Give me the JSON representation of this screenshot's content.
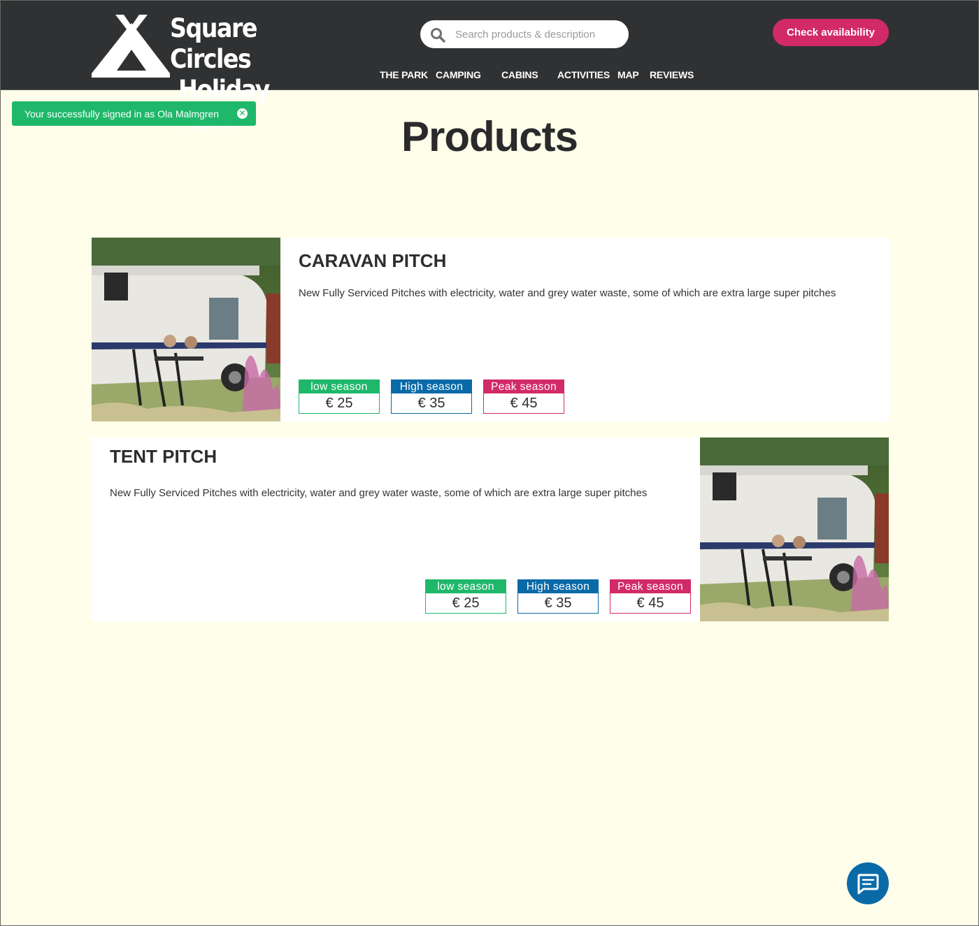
{
  "brand": {
    "line1": "Square Circles",
    "line2": "Holiday Park",
    "logo_icon": "tent-icon"
  },
  "search": {
    "placeholder": "Search products & description",
    "icon": "search-icon"
  },
  "cta": {
    "label": "Check availability"
  },
  "nav": {
    "items": [
      {
        "label": "THE PARK"
      },
      {
        "label": "CAMPING"
      },
      {
        "label": "CABINS"
      },
      {
        "label": "ACTIVITIES"
      },
      {
        "label": "MAP"
      },
      {
        "label": "REVIEWS"
      }
    ]
  },
  "toast": {
    "message": "Your successfully signed in as Ola Malmgren",
    "close_icon": "close-icon"
  },
  "page": {
    "title": "Products"
  },
  "products": [
    {
      "title": "CARAVAN PITCH",
      "description": "New Fully Serviced Pitches with electricity, water and grey water waste, some of which are extra large super pitches",
      "prices": [
        {
          "season": "low season",
          "price": "€ 25",
          "color": "#1fb86a"
        },
        {
          "season": "High season",
          "price": "€ 35",
          "color": "#0a6aa8"
        },
        {
          "season": "Peak season",
          "price": "€ 45",
          "color": "#d22a68"
        }
      ]
    },
    {
      "title": "TENT PITCH",
      "description": "New Fully Serviced Pitches with electricity, water and grey water waste, some of which are extra large super pitches",
      "prices": [
        {
          "season": "low season",
          "price": "€ 25",
          "color": "#1fb86a"
        },
        {
          "season": "High season",
          "price": "€ 35",
          "color": "#0a6aa8"
        },
        {
          "season": "Peak season",
          "price": "€ 45",
          "color": "#d22a68"
        }
      ]
    }
  ],
  "chat": {
    "icon": "chat-icon"
  },
  "colors": {
    "header_bg": "#303133",
    "page_bg": "#fffeea",
    "accent_pink": "#d22a68",
    "accent_green": "#1fb86a",
    "accent_blue": "#0a6aa8"
  }
}
